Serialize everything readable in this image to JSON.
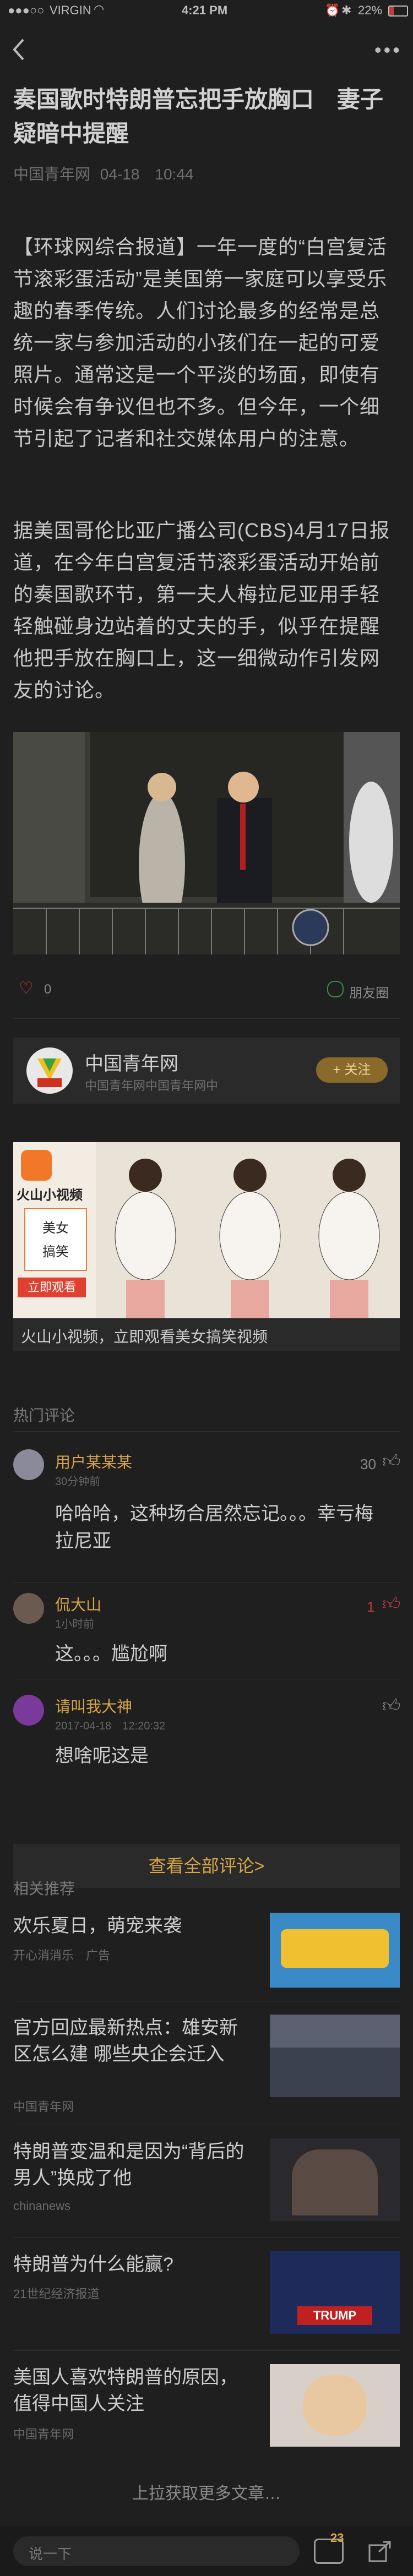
{
  "status": {
    "carrier": "VIRGIN",
    "time": "4:21 PM",
    "battery": "22%"
  },
  "article": {
    "title": "奏国歌时特朗普忘把手放胸口　妻子疑暗中提醒",
    "source": "中国青年网",
    "date": "04-18　10:44",
    "para1": "【环球网综合报道】一年一度的“白宫复活节滚彩蛋活动”是美国第一家庭可以享受乐趣的春季传统。人们讨论最多的经常是总统一家与参加活动的小孩们在一起的可爱照片。通常这是一个平淡的场面，即使有时候会有争议但也不多。但今年，一个细节引起了记者和社交媒体用户的注意。",
    "para2": "据美国哥伦比亚广播公司(CBS)4月17日报道，在今年白宫复活节滚彩蛋活动开始前的奏国歌环节，第一夫人梅拉尼亚用手轻轻触碰身边站着的丈夫的手，似乎在提醒他把手放在胸口上，这一细微动作引发网友的讨论。"
  },
  "like": {
    "count": "0",
    "share_label": "朋友圈"
  },
  "source_card": {
    "name": "中国青年网",
    "sub": "中国青年网中国青年网中",
    "follow": "+ 关注"
  },
  "ad": {
    "brand": "火山小视频",
    "tag1": "美女",
    "tag2": "搞笑",
    "cta": "立即观看",
    "caption": "火山小视频，立即观看美女搞笑视频"
  },
  "comments_header": "热门评论",
  "comments": [
    {
      "name": "用户某某某",
      "time": "30分钟前",
      "body": "哈哈哈，这种场合居然忘记。。。幸亏梅拉尼亚",
      "likes": "30"
    },
    {
      "name": "侃大山",
      "time": "1小时前",
      "body": "这。。。尴尬啊",
      "likes": "1"
    },
    {
      "name": "请叫我大神",
      "time": "2017-04-18　12:20:32",
      "body": "想啥呢这是",
      "likes": ""
    }
  ],
  "view_all": "查看全部评论>",
  "rec_header": "相关推荐",
  "recs": [
    {
      "title": "欢乐夏日，萌宠来袭",
      "src": "开心消消乐　广告"
    },
    {
      "title": "官方回应最新热点：雄安新区怎么建 哪些央企会迁入",
      "src": "中国青年网"
    },
    {
      "title": "特朗普变温和是因为“背后的男人”换成了他",
      "src": "chinanews"
    },
    {
      "title": "特朗普为什么能赢?",
      "src": "21世纪经济报道"
    },
    {
      "title": "美国人喜欢特朗普的原因，值得中国人关注",
      "src": "中国青年网"
    }
  ],
  "load_more": "上拉获取更多文章…",
  "bottom": {
    "placeholder": "说一下",
    "comment_count": "23"
  },
  "colors": {
    "background": "#1f1f1f",
    "accent": "#d8a64a",
    "like_red": "#c23b3b",
    "share_green": "#3a8a4a"
  }
}
